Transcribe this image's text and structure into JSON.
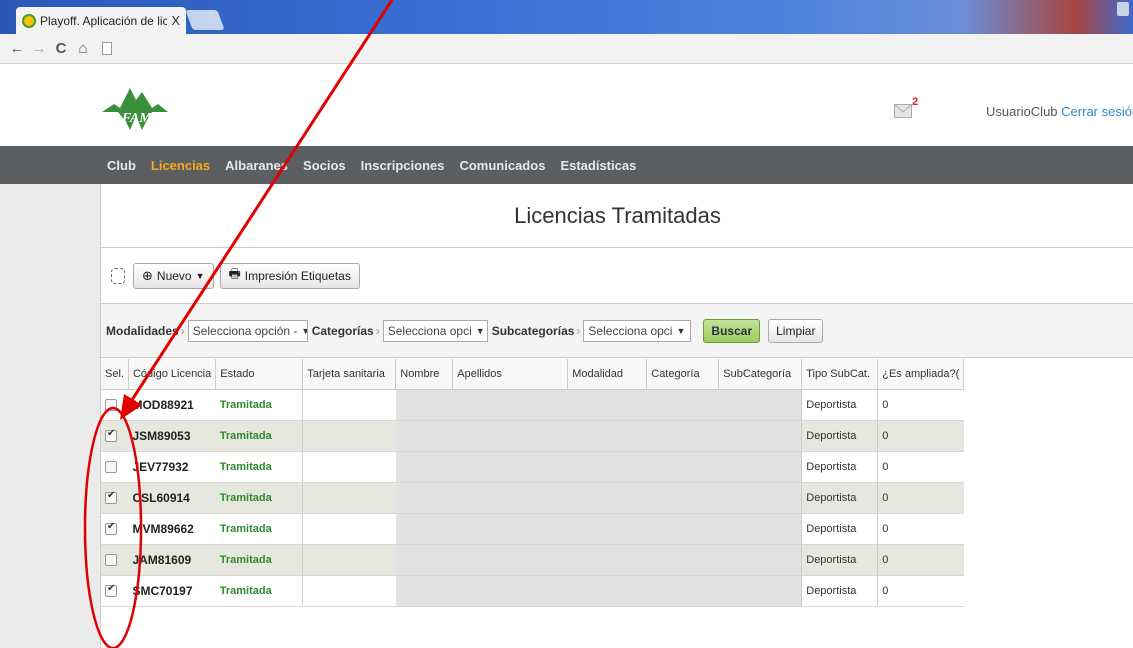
{
  "browser": {
    "tab_title": "Playoff. Aplicación de licer",
    "tab_close": "X",
    "nav": {
      "back": "←",
      "forward": "→",
      "reload": "C",
      "home": "⌂"
    }
  },
  "header": {
    "mail_count": "2",
    "user_name": "UsuarioClub",
    "logout_label": "Cerrar sesión"
  },
  "menu": {
    "items": [
      {
        "label": "Club",
        "active": false
      },
      {
        "label": "Licencias",
        "active": true
      },
      {
        "label": "Albaranes",
        "active": false
      },
      {
        "label": "Socios",
        "active": false
      },
      {
        "label": "Inscripciones",
        "active": false
      },
      {
        "label": "Comunicados",
        "active": false
      },
      {
        "label": "Estadísticas",
        "active": false
      }
    ]
  },
  "page": {
    "title": "Licencias Tramitadas"
  },
  "toolbar": {
    "new_label": "Nuevo",
    "print_label": "Impresión Etiquetas"
  },
  "filters": {
    "modalidades_label": "Modalidades",
    "modalidades_value": "Selecciona opción -",
    "categorias_label": "Categorías",
    "categorias_value": "Selecciona opci",
    "subcategorias_label": "Subcategorías",
    "subcategorias_value": "Selecciona opci",
    "search_label": "Buscar",
    "clear_label": "Limpiar"
  },
  "table": {
    "headers": [
      "Sel.",
      "Código Licencia",
      "Estado",
      "Tarjeta sanitaria",
      "Nombre",
      "Apellidos",
      "Modalidad",
      "Categoría",
      "SubCategoría",
      "Tipo SubCat.",
      "¿Es ampliada?("
    ],
    "rows": [
      {
        "checked": false,
        "codigo": "MOD88921",
        "estado": "Tramitada",
        "tipo": "Deportista",
        "ampliada": "0"
      },
      {
        "checked": true,
        "codigo": "JSM89053",
        "estado": "Tramitada",
        "tipo": "Deportista",
        "ampliada": "0"
      },
      {
        "checked": false,
        "codigo": "JEV77932",
        "estado": "Tramitada",
        "tipo": "Deportista",
        "ampliada": "0"
      },
      {
        "checked": true,
        "codigo": "CSL60914",
        "estado": "Tramitada",
        "tipo": "Deportista",
        "ampliada": "0"
      },
      {
        "checked": true,
        "codigo": "MVM89662",
        "estado": "Tramitada",
        "tipo": "Deportista",
        "ampliada": "0"
      },
      {
        "checked": false,
        "codigo": "JAM81609",
        "estado": "Tramitada",
        "tipo": "Deportista",
        "ampliada": "0"
      },
      {
        "checked": true,
        "codigo": "SMC70197",
        "estado": "Tramitada",
        "tipo": "Deportista",
        "ampliada": "0"
      }
    ]
  },
  "colors": {
    "accent": "#f7a81b",
    "menubar": "#5b5f62",
    "status_ok": "#2e8b2e",
    "annotation": "#e00000"
  }
}
